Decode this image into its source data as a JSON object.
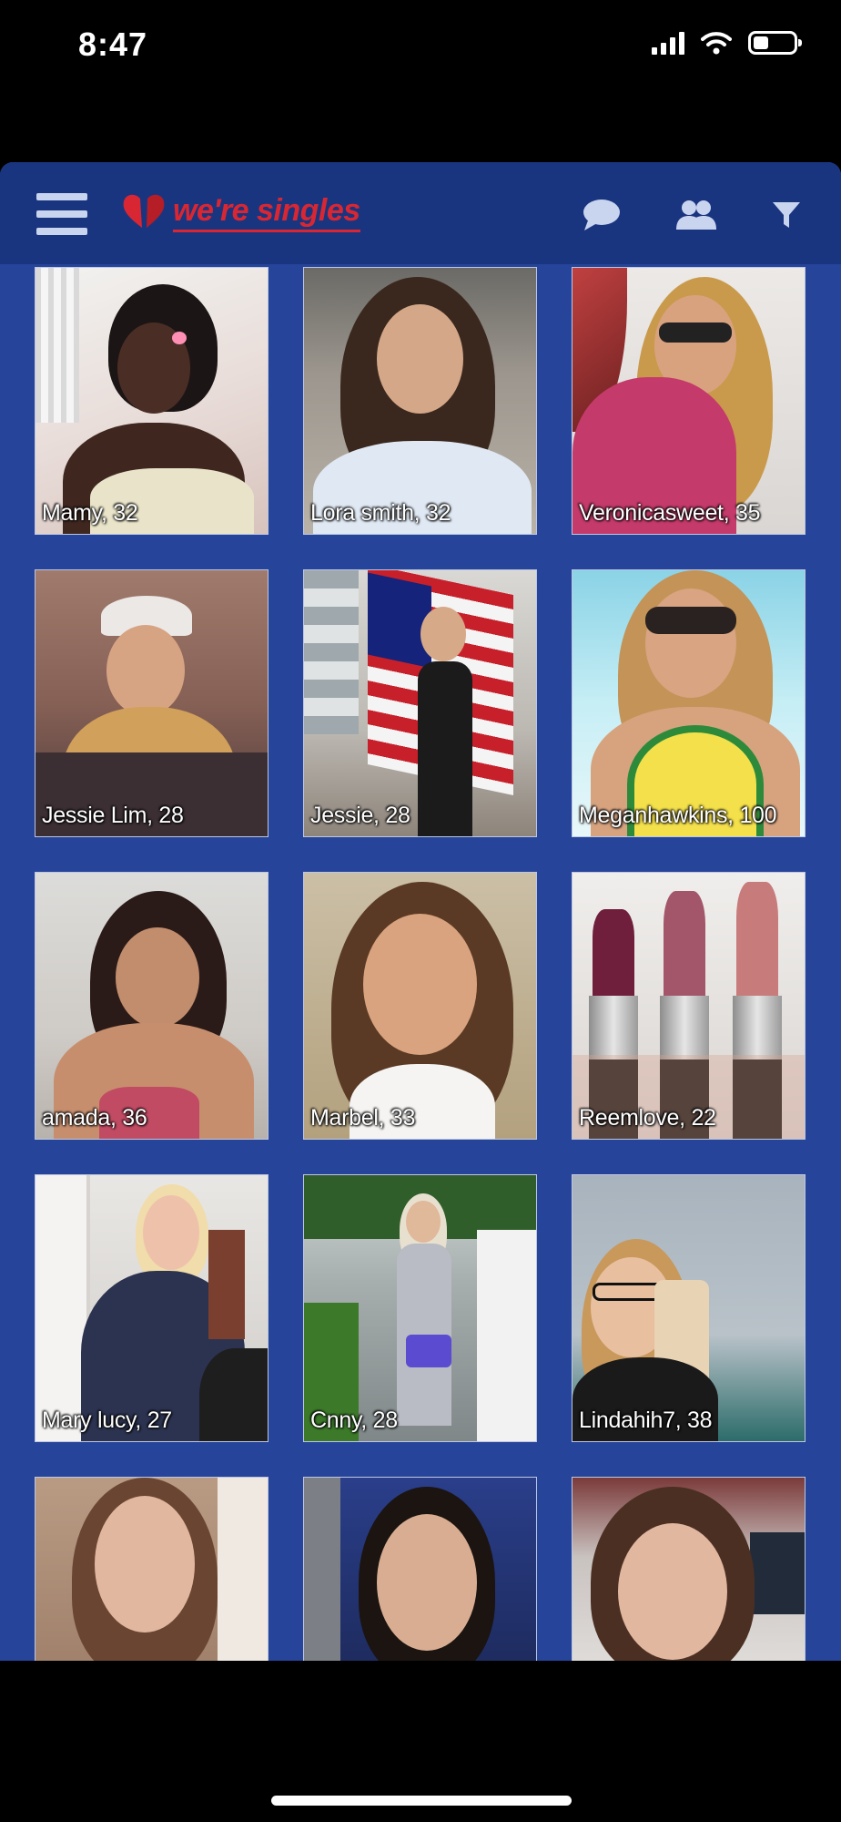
{
  "status_bar": {
    "time": "8:47"
  },
  "header": {
    "logo_text": "we're singles",
    "icons": [
      "menu-icon",
      "chat-icon",
      "people-icon",
      "filter-icon"
    ]
  },
  "colors": {
    "app_background": "#25449a",
    "header_background": "#1a3580",
    "logo_red": "#d82732",
    "icon_light": "#c9d4ef"
  },
  "profiles": [
    {
      "label": "Mamy, 32"
    },
    {
      "label": "Lora smith, 32"
    },
    {
      "label": "Veronicasweet, 35"
    },
    {
      "label": "Jessie Lim, 28"
    },
    {
      "label": "Jessie, 28"
    },
    {
      "label": "Meganhawkins, 100"
    },
    {
      "label": "amada, 36"
    },
    {
      "label": "Marbel, 33"
    },
    {
      "label": "Reemlove, 22"
    },
    {
      "label": "Mary lucy, 27"
    },
    {
      "label": "Cnny, 28"
    },
    {
      "label": "Lindahih7, 38"
    },
    {
      "label": ""
    },
    {
      "label": ""
    },
    {
      "label": ""
    }
  ]
}
